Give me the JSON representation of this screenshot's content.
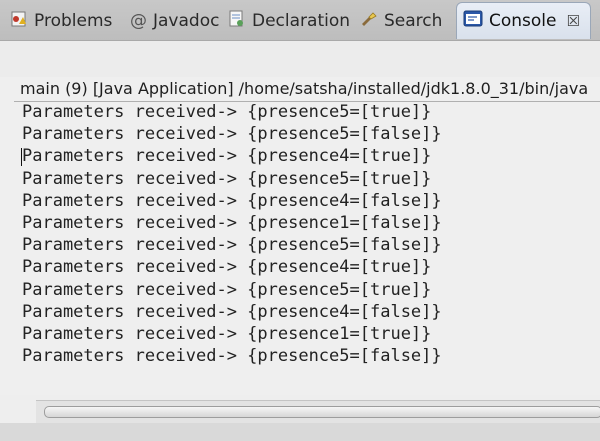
{
  "tabs": [
    {
      "label": "Problems",
      "icon": "problems-icon"
    },
    {
      "label": "Javadoc",
      "icon": "at-sign-icon"
    },
    {
      "label": "Declaration",
      "icon": "declaration-icon"
    },
    {
      "label": "Search",
      "icon": "search-flashlight-icon"
    },
    {
      "label": "Console",
      "icon": "console-icon",
      "active": true
    }
  ],
  "console": {
    "process_label": "main (9) [Java Application] /home/satsha/installed/jdk1.8.0_31/bin/java",
    "lines": [
      "Parameters received-> {presence5=[true]}",
      "Parameters received-> {presence5=[false]}",
      "Parameters received-> {presence4=[true]}",
      "Parameters received-> {presence5=[true]}",
      "Parameters received-> {presence4=[false]}",
      "Parameters received-> {presence1=[false]}",
      "Parameters received-> {presence5=[false]}",
      "Parameters received-> {presence4=[true]}",
      "Parameters received-> {presence5=[true]}",
      "Parameters received-> {presence4=[false]}",
      "Parameters received-> {presence1=[true]}",
      "Parameters received-> {presence5=[false]}"
    ]
  },
  "colors": {
    "active_tab": "#dde4ee",
    "console_icon": "#2a57a8",
    "background": "#efefef"
  }
}
